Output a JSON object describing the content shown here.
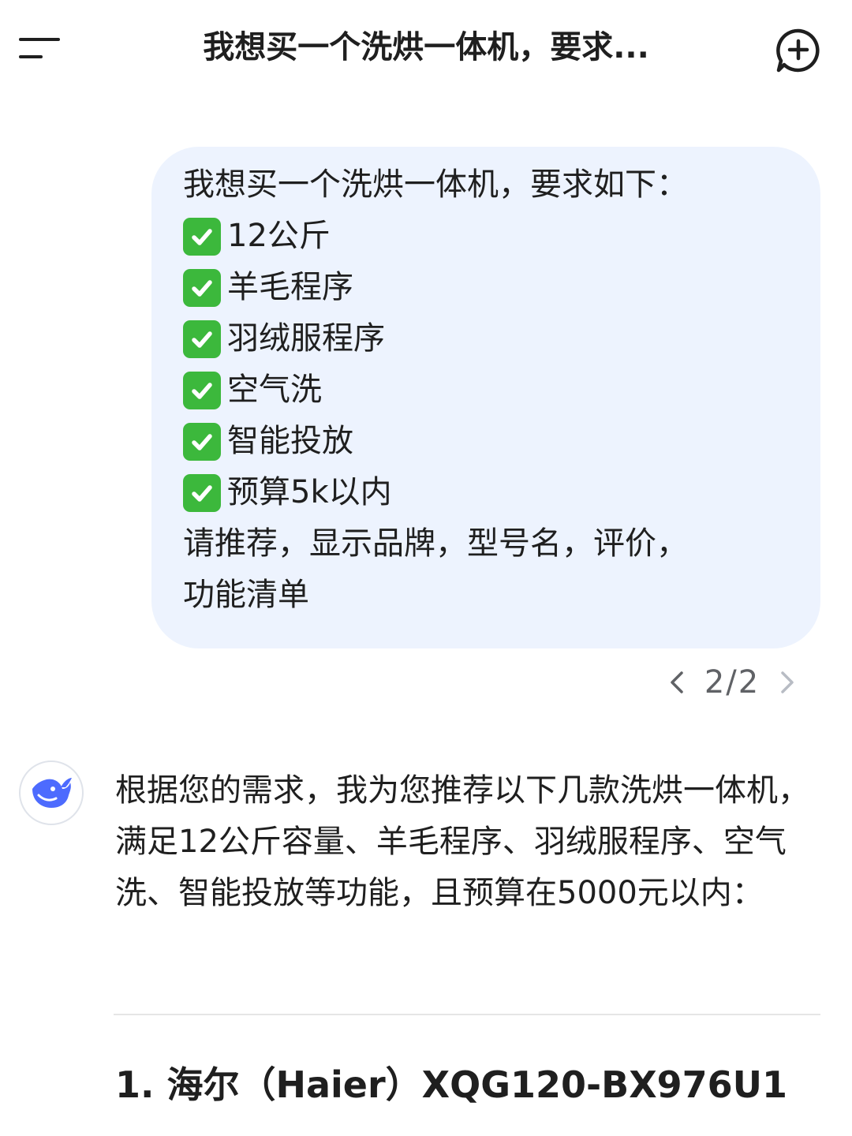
{
  "header": {
    "title": "我想买一个洗烘一体机，要求..."
  },
  "user_message": {
    "intro": "我想买一个洗烘一体机，要求如下：",
    "requirements": [
      "12公斤",
      "羊毛程序",
      "羽绒服程序",
      "空气洗",
      "智能投放",
      "预算5k以内"
    ],
    "request_line1": "请推荐，显示品牌，型号名，评价，",
    "request_line2": "功能清单"
  },
  "pager": {
    "label": "2/2"
  },
  "assistant": {
    "reply": "根据您的需求，我为您推荐以下几款洗烘一体机，满足12公斤容量、羊毛程序、羽绒服程序、空气洗、智能投放等功能，且预算在5000元以内：",
    "first_heading": "1. 海尔（Haier）XQG120-BX976U1"
  },
  "colors": {
    "bubble_bg": "#edf3fe",
    "check_green": "#3cb83c",
    "logo_blue": "#4d6bfe"
  },
  "icons": {
    "menu": "menu-icon",
    "new_chat": "add-chat-icon",
    "check": "check-box-icon",
    "prev": "chevron-left-icon",
    "next": "chevron-right-icon",
    "avatar": "whale-logo-icon"
  }
}
